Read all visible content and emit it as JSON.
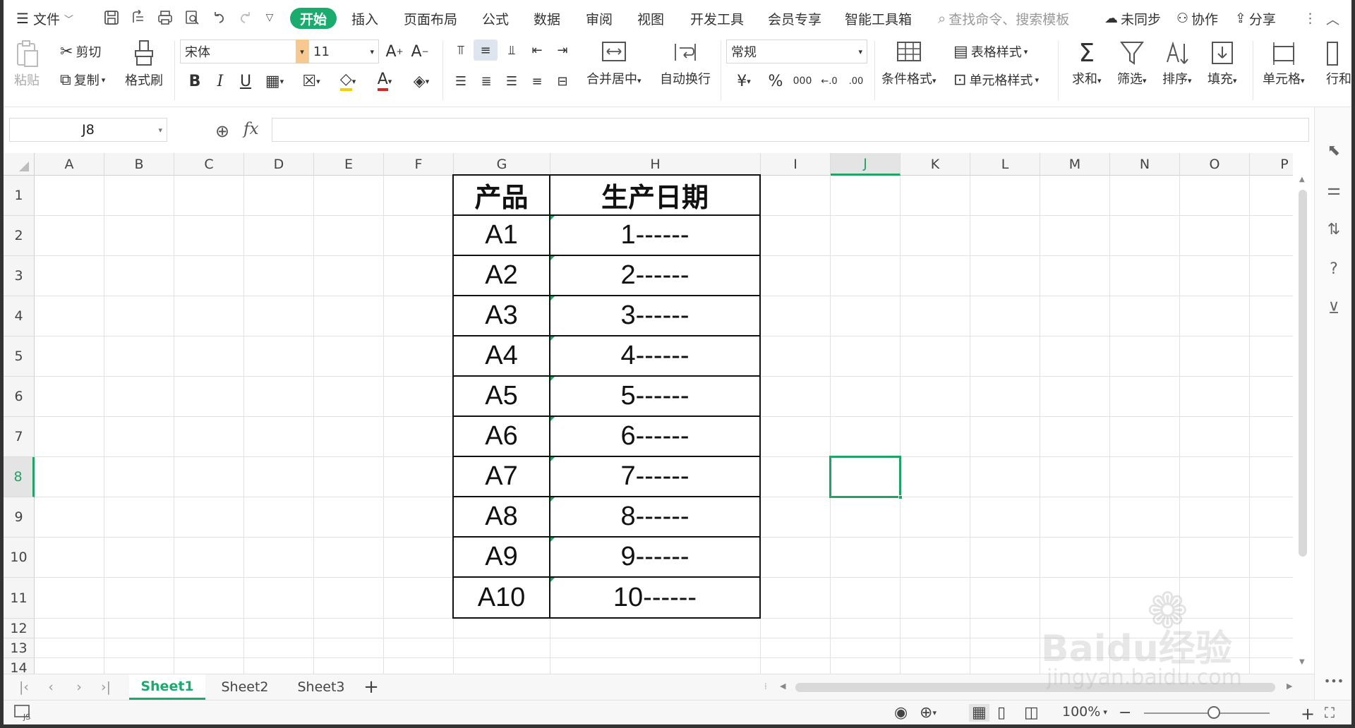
{
  "menubar": {
    "file_label": "文件",
    "tabs": [
      "开始",
      "插入",
      "页面布局",
      "公式",
      "数据",
      "审阅",
      "视图",
      "开发工具",
      "会员专享",
      "智能工具箱"
    ],
    "search_placeholder": "查找命令、搜索模板",
    "sync_label": "未同步",
    "collab_label": "协作",
    "share_label": "分享"
  },
  "ribbon": {
    "paste_label": "粘贴",
    "cut_label": "剪切",
    "copy_label": "复制",
    "format_painter_label": "格式刷",
    "font_name": "宋体",
    "font_size": "11",
    "merge_label": "合并居中",
    "wrap_label": "自动换行",
    "number_format": "常规",
    "cond_format_label": "条件格式",
    "table_style_label": "表格样式",
    "cell_style_label": "单元格样式",
    "sum_label": "求和",
    "filter_label": "筛选",
    "sort_label": "排序",
    "fill_label": "填充",
    "cell_label": "单元格",
    "rowcol_label": "行和"
  },
  "formula_bar": {
    "name_box": "J8",
    "fx": "fx",
    "formula": ""
  },
  "columns": [
    "A",
    "B",
    "C",
    "D",
    "E",
    "F",
    "G",
    "H",
    "I",
    "J",
    "K",
    "L",
    "M",
    "N",
    "O",
    "P"
  ],
  "rows": [
    "1",
    "2",
    "3",
    "4",
    "5",
    "6",
    "7",
    "8",
    "9",
    "10",
    "11",
    "12",
    "13",
    "14"
  ],
  "table": {
    "headers": [
      "产品",
      "生产日期"
    ],
    "rows": [
      [
        "A1",
        "1------"
      ],
      [
        "A2",
        "2------"
      ],
      [
        "A3",
        "3------"
      ],
      [
        "A4",
        "4------"
      ],
      [
        "A5",
        "5------"
      ],
      [
        "A6",
        "6------"
      ],
      [
        "A7",
        "7------"
      ],
      [
        "A8",
        "8------"
      ],
      [
        "A9",
        "9------"
      ],
      [
        "A10",
        "10------"
      ]
    ]
  },
  "active_cell": "J8",
  "sheets": [
    "Sheet1",
    "Sheet2",
    "Sheet3"
  ],
  "active_sheet": "Sheet1",
  "status": {
    "zoom": "100%"
  },
  "watermark": {
    "brand": "Baidu经验",
    "url": "jingyan.baidu.com"
  },
  "colors": {
    "accent": "#1aab6e",
    "selection": "#21a366"
  }
}
